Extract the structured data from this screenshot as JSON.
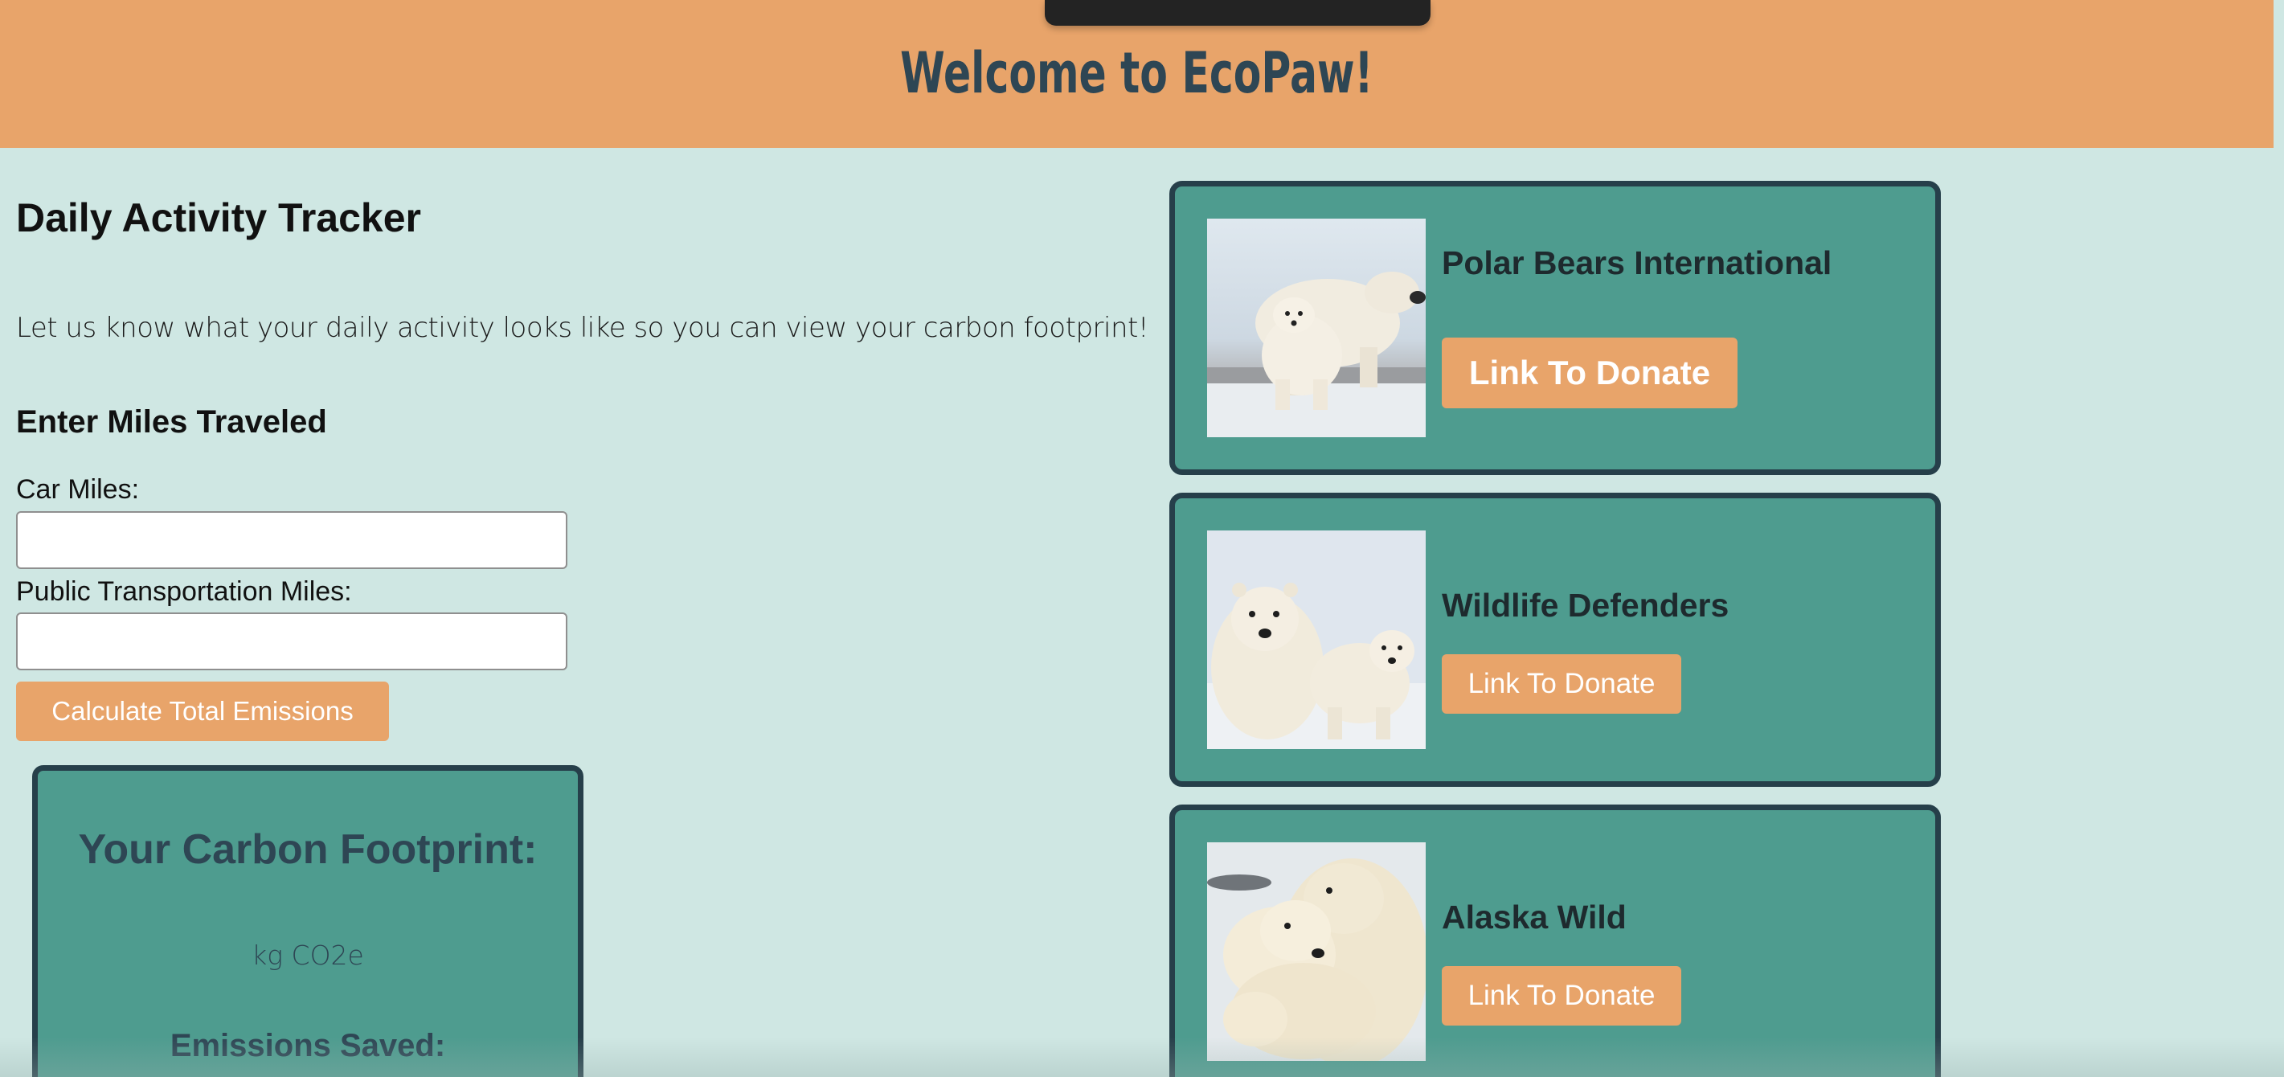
{
  "header": {
    "title": "Welcome to EcoPaw!"
  },
  "tracker": {
    "title": "Daily Activity Tracker",
    "description": "Let us know what your daily activity looks like so you can view your carbon footprint!",
    "miles_heading": "Enter Miles Traveled",
    "car_label": "Car Miles:",
    "car_value": "",
    "transit_label": "Public Transportation Miles:",
    "transit_value": "",
    "calculate_label": "Calculate Total Emissions"
  },
  "footprint": {
    "title": "Your Carbon Footprint:",
    "value": "",
    "unit": "kg CO2e",
    "saved_title": "Emissions Saved:"
  },
  "donations": [
    {
      "name": "Polar Bears International",
      "button": "Link To Donate"
    },
    {
      "name": "Wildlife Defenders",
      "button": "Link To Donate"
    },
    {
      "name": "Alaska Wild",
      "button": "Link To Donate"
    }
  ],
  "colors": {
    "header_bg": "#e8a46a",
    "page_bg": "#cfe7e3",
    "card_bg": "#4e9c8f",
    "card_border": "#263f4a",
    "accent_button": "#e8a46a",
    "title_text": "#2e4654"
  }
}
